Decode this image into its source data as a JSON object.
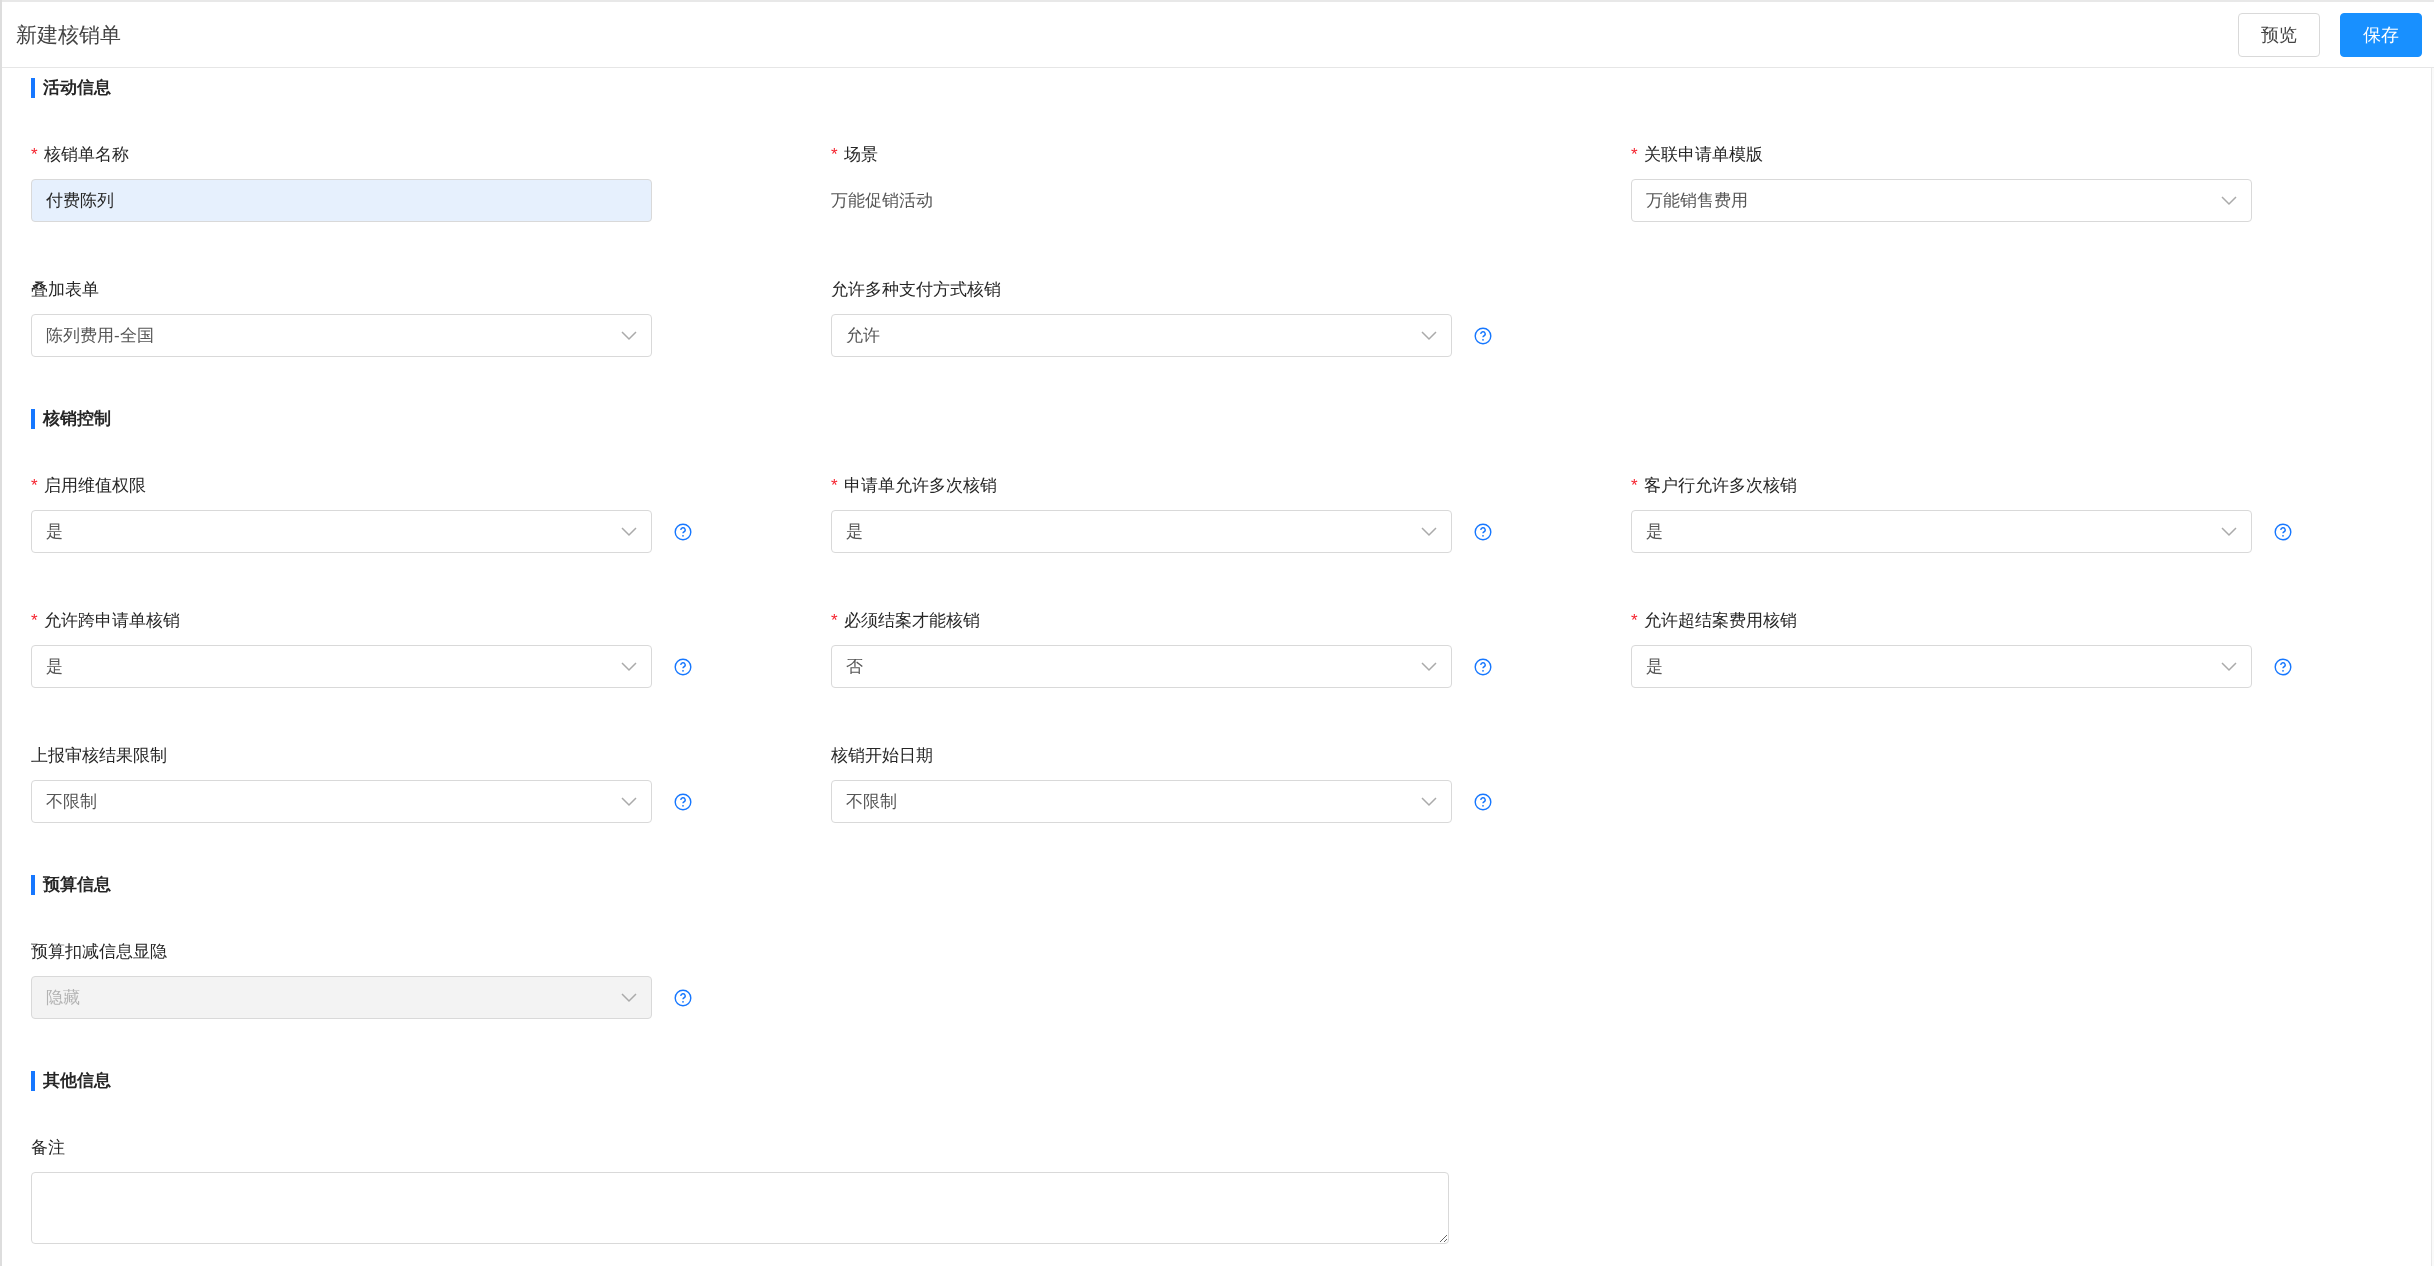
{
  "header": {
    "title": "新建核销单",
    "buttons": [
      {
        "label": "预览",
        "kind": "default"
      },
      {
        "label": "保存",
        "kind": "primary"
      }
    ]
  },
  "sections": [
    {
      "title": "活动信息",
      "fields": [
        {
          "label": "核销单名称",
          "required_mark": "*",
          "kind": "text",
          "value": "付费陈列",
          "help": false,
          "disabled": false
        },
        {
          "label": "场景",
          "required_mark": "*",
          "kind": "static",
          "value": "万能促销活动",
          "help": false,
          "disabled": false
        },
        {
          "label": "关联申请单模版",
          "required_mark": "*",
          "kind": "select",
          "value": "万能销售费用",
          "help": false,
          "disabled": false
        },
        {
          "label": "叠加表单",
          "kind": "select",
          "value": "陈列费用-全国",
          "help": false,
          "disabled": false
        },
        {
          "label": "允许多种支付方式核销",
          "kind": "select",
          "value": "允许",
          "help": true,
          "disabled": false
        }
      ]
    },
    {
      "title": "核销控制",
      "fields": [
        {
          "label": "启用维值权限",
          "required_mark": "*",
          "kind": "select",
          "value": "是",
          "help": true,
          "disabled": false
        },
        {
          "label": "申请单允许多次核销",
          "required_mark": "*",
          "kind": "select",
          "value": "是",
          "help": true,
          "disabled": false
        },
        {
          "label": "客户行允许多次核销",
          "required_mark": "*",
          "kind": "select",
          "value": "是",
          "help": true,
          "disabled": false
        },
        {
          "label": "允许跨申请单核销",
          "required_mark": "*",
          "kind": "select",
          "value": "是",
          "help": true,
          "disabled": false
        },
        {
          "label": "必须结案才能核销",
          "required_mark": "*",
          "kind": "select",
          "value": "否",
          "help": true,
          "disabled": false
        },
        {
          "label": "允许超结案费用核销",
          "required_mark": "*",
          "kind": "select",
          "value": "是",
          "help": true,
          "disabled": false
        },
        {
          "label": "上报审核结果限制",
          "kind": "select",
          "value": "不限制",
          "help": true,
          "disabled": false
        },
        {
          "label": "核销开始日期",
          "kind": "select",
          "value": "不限制",
          "help": true,
          "disabled": false
        }
      ]
    },
    {
      "title": "预算信息",
      "fields": [
        {
          "label": "预算扣减信息显隐",
          "kind": "select",
          "value": "隐藏",
          "help": true,
          "disabled": true
        }
      ]
    },
    {
      "title": "其他信息",
      "fields": [
        {
          "label": "备注",
          "kind": "textarea",
          "help": false,
          "disabled": false
        }
      ]
    }
  ]
}
